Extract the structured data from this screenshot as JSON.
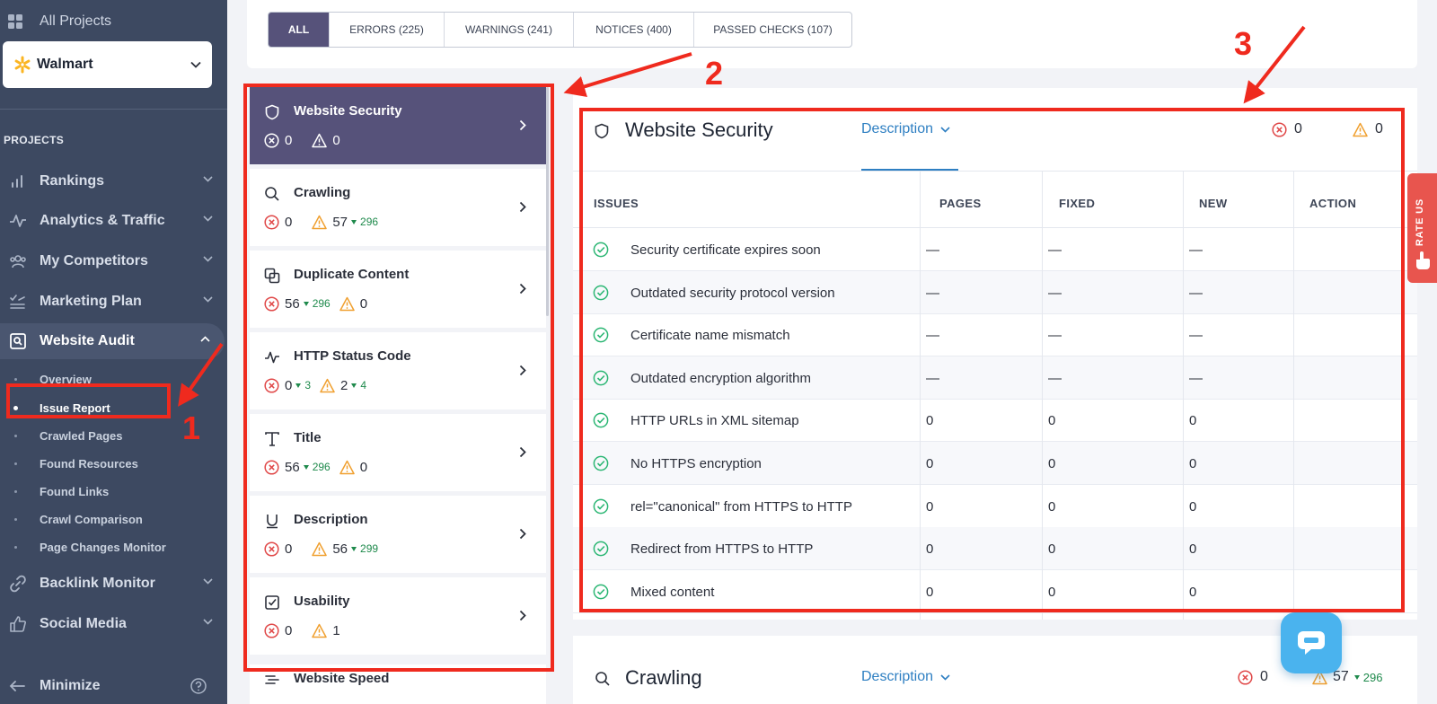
{
  "sidebar": {
    "all_projects": "All Projects",
    "project": "Walmart",
    "section_label": "PROJECTS",
    "nav": [
      {
        "label": "Rankings",
        "icon": "bar-chart-icon"
      },
      {
        "label": "Analytics & Traffic",
        "icon": "pulse-icon"
      },
      {
        "label": "My Competitors",
        "icon": "people-icon"
      },
      {
        "label": "Marketing Plan",
        "icon": "checklist-icon"
      },
      {
        "label": "Website Audit",
        "icon": "audit-icon"
      }
    ],
    "audit_subitems": [
      "Overview",
      "Issue Report",
      "Crawled Pages",
      "Found Resources",
      "Found Links",
      "Crawl Comparison",
      "Page Changes Monitor"
    ],
    "nav_bottom": [
      {
        "label": "Backlink Monitor",
        "icon": "link-icon"
      },
      {
        "label": "Social Media",
        "icon": "thumbs-up-icon"
      }
    ],
    "minimize": "Minimize"
  },
  "filters": [
    {
      "label": "ALL"
    },
    {
      "label": "ERRORS (225)"
    },
    {
      "label": "WARNINGS (241)"
    },
    {
      "label": "NOTICES (400)"
    },
    {
      "label": "PASSED CHECKS (107)"
    }
  ],
  "categories": [
    {
      "name": "Website Security",
      "errors": "0",
      "warnings": "0"
    },
    {
      "name": "Crawling",
      "errors": "0",
      "warnings": "57",
      "warnings_delta": "296"
    },
    {
      "name": "Duplicate Content",
      "errors": "56",
      "errors_delta": "296",
      "warnings": "0"
    },
    {
      "name": "HTTP Status Code",
      "errors": "0",
      "errors_delta": "3",
      "warnings": "2",
      "warnings_delta": "4"
    },
    {
      "name": "Title",
      "errors": "56",
      "errors_delta": "296",
      "warnings": "0"
    },
    {
      "name": "Description",
      "errors": "0",
      "warnings": "56",
      "warnings_delta": "299"
    },
    {
      "name": "Usability",
      "errors": "0",
      "warnings": "1"
    },
    {
      "name": "Website Speed"
    }
  ],
  "detail": {
    "title": "Website Security",
    "description_link": "Description",
    "errors": "0",
    "warnings": "0",
    "columns": [
      "ISSUES",
      "PAGES",
      "FIXED",
      "NEW",
      "ACTION"
    ],
    "rows": [
      {
        "issue": "Security certificate expires soon",
        "pages": "—",
        "fixed": "—",
        "new": "—"
      },
      {
        "issue": "Outdated security protocol version",
        "pages": "—",
        "fixed": "—",
        "new": "—"
      },
      {
        "issue": "Certificate name mismatch",
        "pages": "—",
        "fixed": "—",
        "new": "—"
      },
      {
        "issue": "Outdated encryption algorithm",
        "pages": "—",
        "fixed": "—",
        "new": "—"
      },
      {
        "issue": "HTTP URLs in XML sitemap",
        "pages": "0",
        "fixed": "0",
        "new": "0"
      },
      {
        "issue": "No HTTPS encryption",
        "pages": "0",
        "fixed": "0",
        "new": "0"
      },
      {
        "issue": "rel=\"canonical\" from HTTPS to HTTP",
        "pages": "0",
        "fixed": "0",
        "new": "0"
      },
      {
        "issue": "Redirect from HTTPS to HTTP",
        "pages": "0",
        "fixed": "0",
        "new": "0"
      },
      {
        "issue": "Mixed content",
        "pages": "0",
        "fixed": "0",
        "new": "0"
      }
    ]
  },
  "crawling_card": {
    "title": "Crawling",
    "description_link": "Description",
    "errors": "0",
    "warnings": "57",
    "warnings_delta": "296"
  },
  "rate_us": "RATE US",
  "annotations": [
    "1",
    "2",
    "3"
  ],
  "colors": {
    "sidebar_bg": "#3d4961",
    "accent_purple": "#56527a",
    "error_red": "#e04848",
    "warning_orange": "#f0a030",
    "success_green": "#2bb673",
    "link_blue": "#2e7fc2",
    "annotation_red": "#ef2a1e"
  }
}
